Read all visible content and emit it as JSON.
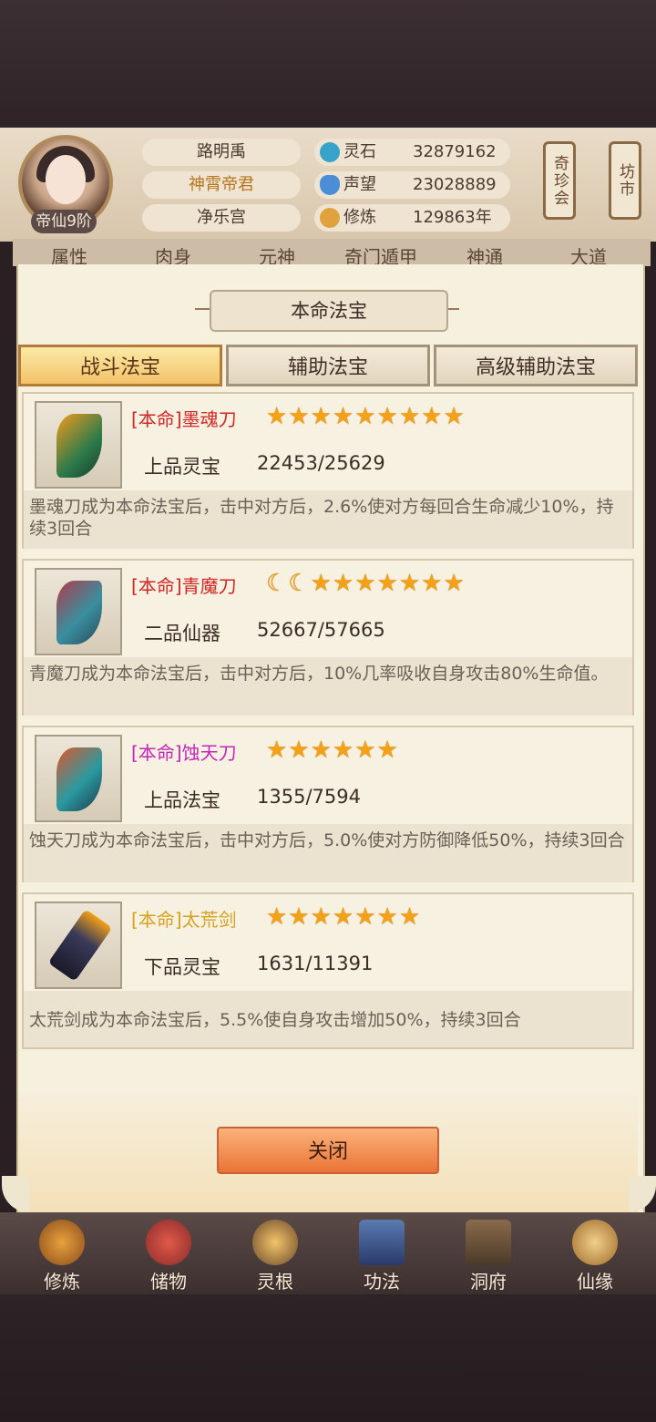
{
  "player": {
    "rank": "帝仙9阶",
    "name": "路明禹",
    "title": "神霄帝君",
    "sect": "净乐宫"
  },
  "resources": [
    {
      "label": "灵石",
      "value": "32879162",
      "icon": "spirit-stone-icon"
    },
    {
      "label": "声望",
      "value": "23028889",
      "icon": "crystal-icon"
    },
    {
      "label": "修炼",
      "value": "129863年",
      "icon": "meditation-icon"
    }
  ],
  "side_buttons": {
    "treasure": "奇珍会",
    "market": "坊市"
  },
  "top_tabs": [
    "属性",
    "肉身",
    "元神",
    "奇门遁甲",
    "神通",
    "大道"
  ],
  "panel": {
    "title": "本命法宝",
    "tabs": [
      "战斗法宝",
      "辅助法宝",
      "高级辅助法宝"
    ],
    "active_tab": "战斗法宝",
    "items": [
      {
        "name": "[本命]墨魂刀",
        "name_color": "#d32626",
        "stars": "★★★★★★★★★",
        "grade": "上品灵宝",
        "exp": "22453/25629",
        "desc": "墨魂刀成为本命法宝后，击中对方后，2.6%使对方每回合生命减少10%，持续3回合"
      },
      {
        "name": "[本命]青魔刀",
        "name_color": "#d32626",
        "moons": "☾☾",
        "stars": "★★★★★★★",
        "grade": "二品仙器",
        "exp": "52667/57665",
        "desc": "青魔刀成为本命法宝后，击中对方后，10%几率吸收自身攻击80%生命值。"
      },
      {
        "name": "[本命]蚀天刀",
        "name_color": "#c427b9",
        "stars": "★★★★★★",
        "grade": "上品法宝",
        "exp": "1355/7594",
        "desc": "蚀天刀成为本命法宝后，击中对方后，5.0%使对方防御降低50%，持续3回合"
      },
      {
        "name": "[本命]太荒剑",
        "name_color": "#d6a21f",
        "stars": "★★★★★★★",
        "grade": "下品灵宝",
        "exp": "1631/11391",
        "desc": "太荒剑成为本命法宝后，5.5%使自身攻击增加50%，持续3回合"
      }
    ],
    "close_label": "关闭"
  },
  "bottom_nav": [
    "修炼",
    "储物",
    "灵根",
    "功法",
    "洞府",
    "仙缘"
  ]
}
